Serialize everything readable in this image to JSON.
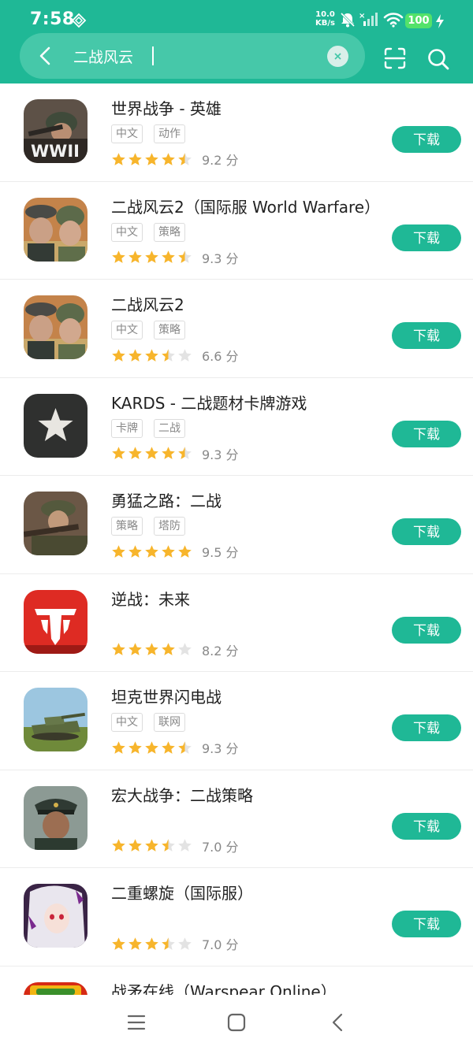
{
  "status_bar": {
    "time": "7:58",
    "net_speed_value": "10.0",
    "net_speed_unit": "KB/s",
    "battery": "100",
    "icons": [
      "location-diamond-icon",
      "mute-bell-icon",
      "signal-icon",
      "wifi-icon",
      "battery-icon",
      "charging-icon"
    ]
  },
  "search": {
    "query": "二战风云",
    "icons": {
      "back": "back-arrow-icon",
      "clear": "clear-icon",
      "scan": "scan-icon",
      "search": "search-icon"
    }
  },
  "colors": {
    "brand": "#1fb896",
    "star_filled": "#f7b52c",
    "star_empty": "#e3e3e3"
  },
  "download_label": "下载",
  "score_suffix": "分",
  "apps": [
    {
      "name": "世界战争 - 英雄",
      "tags": [
        "中文",
        "动作"
      ],
      "rating": 4.5,
      "score": "9.2",
      "icon": "wwii-soldier-icon"
    },
    {
      "name": "二战风云2（国际服 World Warfare）",
      "tags": [
        "中文",
        "策略"
      ],
      "rating": 4.5,
      "score": "9.3",
      "icon": "two-soldiers-icon"
    },
    {
      "name": "二战风云2",
      "tags": [
        "中文",
        "策略"
      ],
      "rating": 3.5,
      "score": "6.6",
      "icon": "two-soldiers-icon"
    },
    {
      "name": "KARDS - 二战题材卡牌游戏",
      "tags": [
        "卡牌",
        "二战"
      ],
      "rating": 4.5,
      "score": "9.3",
      "icon": "star-card-icon"
    },
    {
      "name": "勇猛之路：二战",
      "tags": [
        "策略",
        "塔防"
      ],
      "rating": 5,
      "score": "9.5",
      "icon": "rifleman-icon"
    },
    {
      "name": "逆战：未来",
      "tags": [],
      "rating": 4,
      "score": "8.2",
      "icon": "nizhan-logo-icon"
    },
    {
      "name": "坦克世界闪电战",
      "tags": [
        "中文",
        "联网"
      ],
      "rating": 4.5,
      "score": "9.3",
      "icon": "tank-icon"
    },
    {
      "name": "宏大战争：二战策略",
      "tags": [],
      "rating": 3.5,
      "score": "7.0",
      "icon": "general-icon"
    },
    {
      "name": "二重螺旋（国际服）",
      "tags": [],
      "rating": 3.5,
      "score": "7.0",
      "icon": "anime-girl-icon"
    },
    {
      "name": "战矛在线（Warspear Online）",
      "tags": [],
      "rating": 0,
      "score": "",
      "icon": "warspear-icon"
    }
  ],
  "nav_bar": {
    "icons": [
      "menu-icon",
      "home-icon",
      "back-icon"
    ]
  }
}
